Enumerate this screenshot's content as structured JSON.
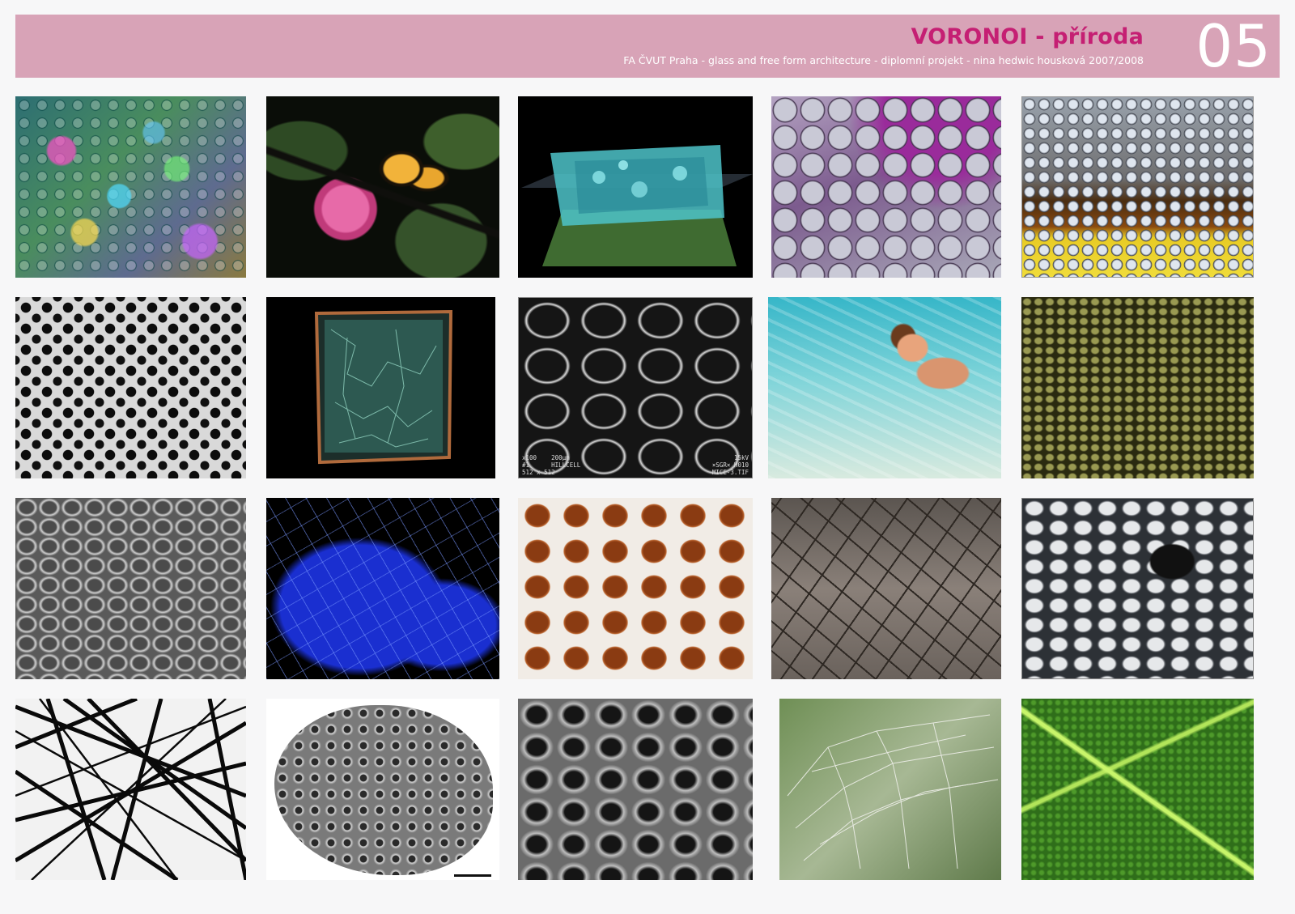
{
  "header": {
    "title": "VORONOI - příroda",
    "subtitle": "FA ČVUT Praha - glass and free form architecture  - diplomní projekt - nina hedwic housková 2007/2008",
    "page_number": "05",
    "background_color": "#d8a3b7",
    "title_color": "#c51f73"
  },
  "gallery": {
    "photo_9_caption_left": "x100    200µm\n#1      HILLCELL\n512 x 512",
    "photo_9_caption_right": "15kV\n×SGR× H010\nMICE-3.TIF"
  }
}
